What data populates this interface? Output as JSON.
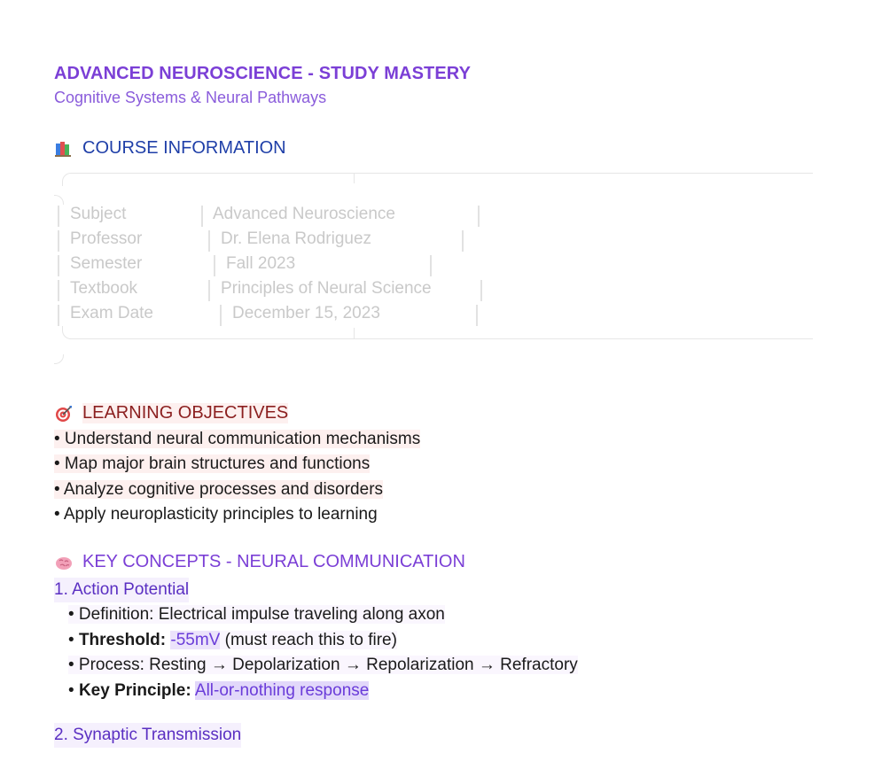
{
  "document": {
    "title": "ADVANCED NEUROSCIENCE - STUDY MASTERY",
    "subtitle": "Cognitive Systems & Neural Pathways"
  },
  "course_info": {
    "heading": "COURSE INFORMATION",
    "icon": "books-icon",
    "rows": [
      {
        "label": "Subject",
        "value": "Advanced Neuroscience"
      },
      {
        "label": "Professor",
        "value": "Dr. Elena Rodriguez"
      },
      {
        "label": "Semester",
        "value": "Fall 2023"
      },
      {
        "label": "Textbook",
        "value": "Principles of Neural Science"
      },
      {
        "label": "Exam Date",
        "value": "December 15, 2023"
      }
    ]
  },
  "objectives": {
    "heading": "LEARNING OBJECTIVES",
    "icon": "target-icon",
    "items": [
      "• Understand neural communication mechanisms",
      "• Map major brain structures and functions",
      "• Analyze cognitive processes and disorders",
      "• Apply neuroplasticity principles to learning"
    ]
  },
  "key_concepts": {
    "heading": "KEY CONCEPTS - NEURAL COMMUNICATION",
    "icon": "brain-icon",
    "action_potential": {
      "heading": "1. Action Potential",
      "definition": "• Definition: Electrical impulse traveling along axon",
      "threshold_label": "Threshold:",
      "threshold_value": "-55mV",
      "threshold_note": " (must reach this to fire)",
      "process": "• Process: Resting → Depolarization → Repolarization → Refractory",
      "principle_label": "Key Principle:",
      "principle_value": "All-or-nothing response"
    },
    "synaptic": {
      "heading": "2. Synaptic Transmission"
    }
  },
  "colors": {
    "title": "#7b3fd6",
    "course_heading": "#1f3fa8",
    "objectives_heading": "#8b1f1f",
    "key_heading": "#7b3fd6"
  }
}
